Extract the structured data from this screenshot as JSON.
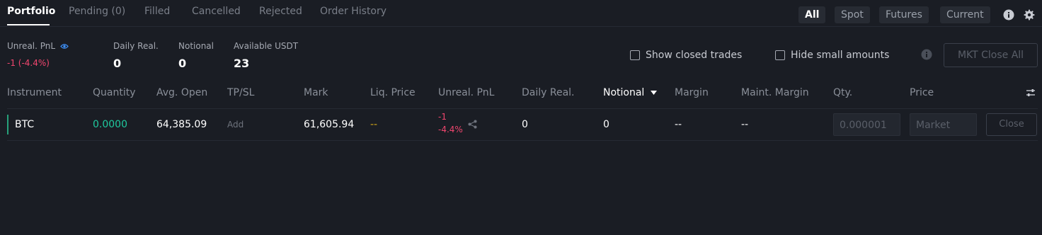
{
  "tabs": [
    {
      "label": "Portfolio"
    },
    {
      "label": "Pending (0)"
    },
    {
      "label": "Filled"
    },
    {
      "label": "Cancelled"
    },
    {
      "label": "Rejected"
    },
    {
      "label": "Order History"
    }
  ],
  "filters": [
    {
      "label": "All"
    },
    {
      "label": "Spot"
    },
    {
      "label": "Futures"
    },
    {
      "label": "Current"
    }
  ],
  "summary": {
    "unreal_pnl": {
      "label": "Unreal. PnL",
      "value": "-1 (-4.4%)"
    },
    "daily_real": {
      "label": "Daily Real.",
      "value": "0"
    },
    "notional": {
      "label": "Notional",
      "value": "0"
    },
    "available": {
      "label": "Available USDT",
      "value": "23"
    }
  },
  "options": {
    "show_closed": "Show closed trades",
    "hide_small": "Hide small amounts"
  },
  "mkt_close_all": "MKT Close All",
  "table": {
    "headers": [
      "Instrument",
      "Quantity",
      "Avg. Open",
      "TP/SL",
      "Mark",
      "Liq. Price",
      "Unreal. PnL",
      "Daily Real.",
      "Notional",
      "Margin",
      "Maint. Margin",
      "Qty.",
      "Price"
    ],
    "rows": [
      {
        "instrument": "BTC",
        "quantity": "0.0000",
        "avg_open": "64,385.09",
        "tpsl": "Add",
        "mark": "61,605.94",
        "liq_price": "--",
        "unreal_pnl": "-1",
        "unreal_pnl_pct": "-4.4%",
        "daily_real": "0",
        "notional": "0",
        "margin": "--",
        "maint_margin": "--",
        "qty_placeholder": "0.000001",
        "price_placeholder": "Market",
        "close_label": "Close"
      }
    ]
  },
  "colors": {
    "background": "#1a1d24",
    "positive": "#1fc99e",
    "negative": "#f0466e",
    "warning": "#d4a617"
  },
  "icons": {
    "eye": "eye-icon",
    "info": "info-icon",
    "settings": "gear-icon",
    "sort": "sort-down-icon",
    "share": "share-icon",
    "columns": "column-settings-icon"
  }
}
